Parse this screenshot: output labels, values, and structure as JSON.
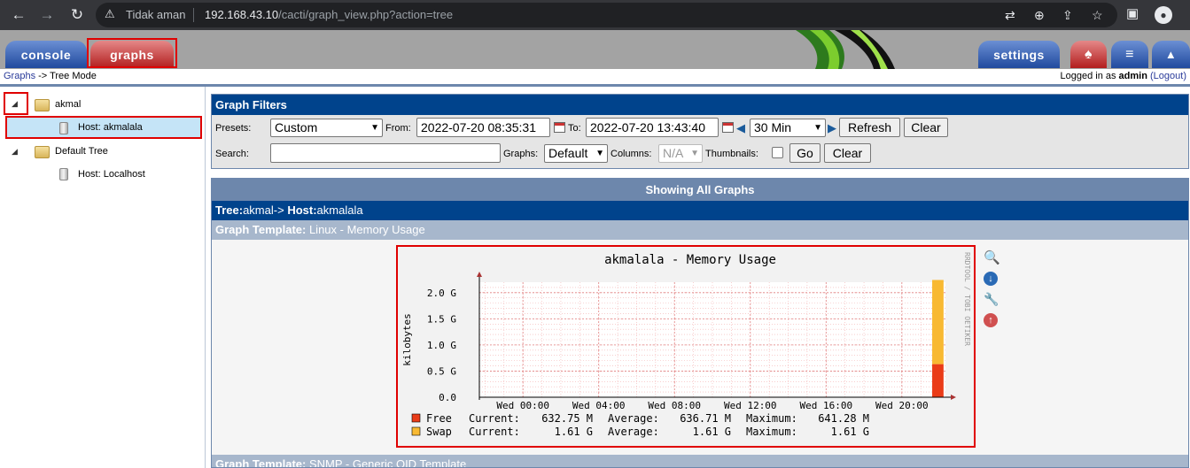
{
  "browser": {
    "security": "Tidak aman",
    "url_host": "192.168.43.10",
    "url_path": "/cacti/graph_view.php?action=tree"
  },
  "tabs": {
    "console": "console",
    "graphs": "graphs",
    "settings": "settings"
  },
  "breadcrumb": {
    "link": "Graphs",
    "rest": " -> Tree Mode",
    "logged_prefix": "Logged in as ",
    "user": "admin",
    "logout": "(Logout)"
  },
  "tree": {
    "nodes": [
      {
        "label": "akmal"
      },
      {
        "label": "Host: akmalala"
      },
      {
        "label": "Default Tree"
      },
      {
        "label": "Host: Localhost"
      }
    ]
  },
  "filters": {
    "title": "Graph Filters",
    "presets_label": "Presets:",
    "preset_value": "Custom",
    "from_label": "From:",
    "from_value": "2022-07-20 08:35:31",
    "to_label": "To:",
    "to_value": "2022-07-20 13:43:40",
    "timespan_value": "30 Min",
    "refresh": "Refresh",
    "clear": "Clear",
    "search_label": "Search:",
    "search_value": "",
    "graphs_label": "Graphs:",
    "graphs_value": "Default",
    "columns_label": "Columns:",
    "columns_value": "N/A",
    "thumbnails_label": "Thumbnails:",
    "go": "Go",
    "clear2": "Clear"
  },
  "graphs": {
    "heading": "Showing All Graphs",
    "tree_prefix": "Tree:",
    "tree_name": "akmal",
    "arrow": "-> ",
    "host_prefix": "Host:",
    "host_name": "akmalala",
    "template1_prefix": "Graph Template:",
    "template1_name": " Linux - Memory Usage",
    "template2_prefix": "Graph Template:",
    "template2_name": " SNMP - Generic OID Template"
  },
  "chart_data": {
    "type": "area",
    "title": "akmalala - Memory Usage",
    "ylabel": "kilobytes",
    "watermark": "RRDTOOL / TOBI OETIKER",
    "ylim": [
      0,
      2.2
    ],
    "yticks": [
      "0.0",
      "0.5 G",
      "1.0 G",
      "1.5 G",
      "2.0 G"
    ],
    "ytick_values": [
      0,
      0.5,
      1.0,
      1.5,
      2.0
    ],
    "xticks": [
      "Wed 00:00",
      "Wed 04:00",
      "Wed 08:00",
      "Wed 12:00",
      "Wed 16:00",
      "Wed 20:00"
    ],
    "xlim_hours": [
      -2.3,
      22.3
    ],
    "xtick_hours": [
      0,
      4,
      8,
      12,
      16,
      20
    ],
    "series": [
      {
        "name": "Free",
        "color": "#ea3c18",
        "stack_value": 0.633,
        "x_start_hour": 21.6,
        "x_end_hour": 22.2
      },
      {
        "name": "Swap",
        "color": "#f8b932",
        "stack_value": 1.61,
        "x_start_hour": 21.6,
        "x_end_hour": 22.2
      }
    ],
    "legend": [
      {
        "name": "Free",
        "current_label": "Current:",
        "current": "632.75 M",
        "average_label": "Average:",
        "average": "636.71 M",
        "maximum_label": "Maximum:",
        "maximum": "641.28 M"
      },
      {
        "name": "Swap",
        "current_label": "Current:",
        "current": "1.61 G",
        "average_label": "Average:",
        "average": "1.61 G",
        "maximum_label": "Maximum:",
        "maximum": "1.61 G"
      }
    ],
    "grid": true
  },
  "colors": {
    "brand_blue": "#00438c",
    "highlight_red": "#e00000"
  }
}
